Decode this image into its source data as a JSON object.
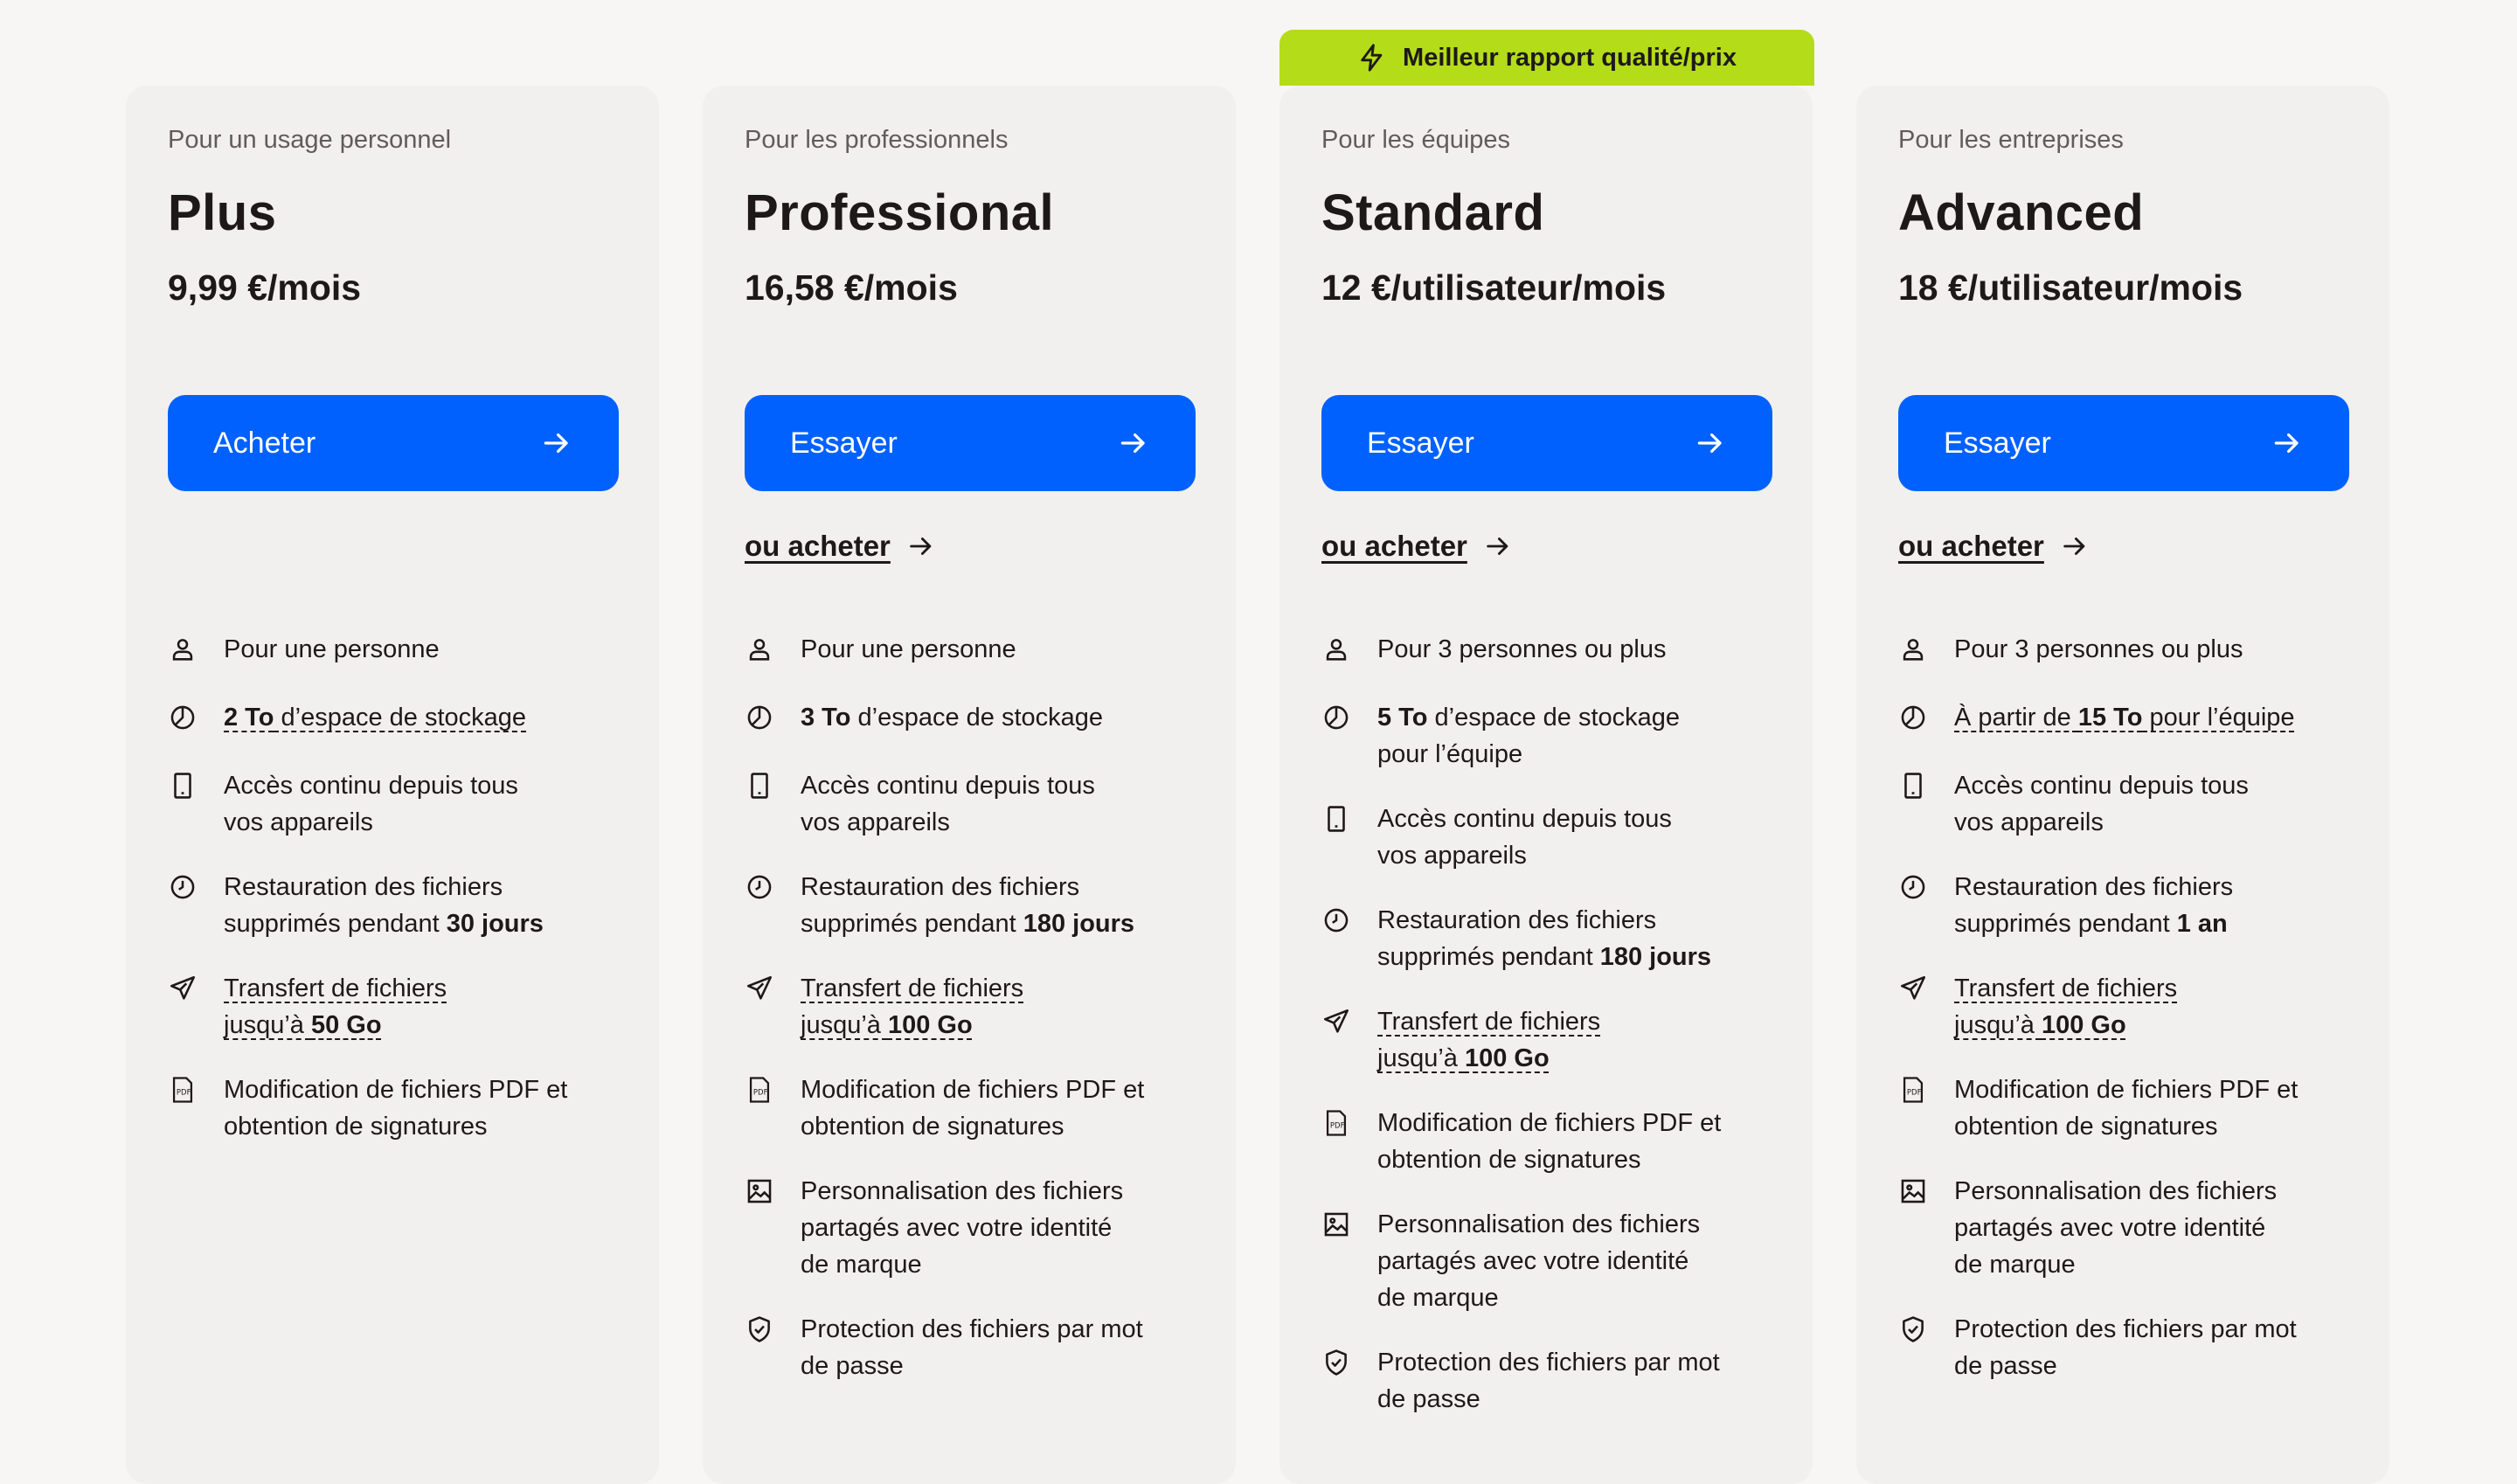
{
  "badge": {
    "icon": "lightning-icon",
    "label": "Meilleur rapport qualité/prix"
  },
  "plans": [
    {
      "audience": "Pour un usage personnel",
      "name": "Plus",
      "price": "9,99 €/mois",
      "cta_label": "Acheter",
      "features": {
        "people": "Pour une personne",
        "storage_value": "2 To",
        "storage_text": " d’espace de stockage",
        "access_line1": "Accès continu depuis tous",
        "access_line2": "vos appareils",
        "restore_line1": "Restauration des fichiers",
        "restore_prefix": "supprimés pendant ",
        "restore_value": "30 jours",
        "transfer_line1": "Transfert de fichiers",
        "transfer_prefix": "jusqu’à ",
        "transfer_value": "50 Go",
        "pdf_line1": "Modification de fichiers PDF et",
        "pdf_line2": "obtention de signatures"
      }
    },
    {
      "audience": "Pour les professionnels",
      "name": "Professional",
      "price": "16,58 €/mois",
      "cta_label": "Essayer",
      "buy_link": "ou acheter",
      "features": {
        "people": "Pour une personne",
        "storage_value": "3 To",
        "storage_text": " d’espace de stockage",
        "access_line1": "Accès continu depuis tous",
        "access_line2": "vos appareils",
        "restore_line1": "Restauration des fichiers",
        "restore_prefix": "supprimés pendant ",
        "restore_value": "180 jours",
        "transfer_line1": "Transfert de fichiers",
        "transfer_prefix": "jusqu’à ",
        "transfer_value": "100 Go",
        "pdf_line1": "Modification de fichiers PDF et",
        "pdf_line2": "obtention de signatures",
        "brand_line1": "Personnalisation des fichiers",
        "brand_line2": "partagés avec votre identité",
        "brand_line3": "de marque",
        "password_line1": "Protection des fichiers par mot",
        "password_line2": "de passe"
      }
    },
    {
      "audience": "Pour les équipes",
      "name": "Standard",
      "price": "12 €/utilisateur/mois",
      "cta_label": "Essayer",
      "buy_link": "ou acheter",
      "features": {
        "people": "Pour 3 personnes ou plus",
        "storage_value": "5 To",
        "storage_text": " d’espace de stockage",
        "storage_line2": "pour l’équipe",
        "access_line1": "Accès continu depuis tous",
        "access_line2": "vos appareils",
        "restore_line1": "Restauration des fichiers",
        "restore_prefix": "supprimés pendant ",
        "restore_value": "180 jours",
        "transfer_line1": "Transfert de fichiers",
        "transfer_prefix": "jusqu’à ",
        "transfer_value": "100 Go",
        "pdf_line1": "Modification de fichiers PDF et",
        "pdf_line2": "obtention de signatures",
        "brand_line1": "Personnalisation des fichiers",
        "brand_line2": "partagés avec votre identité",
        "brand_line3": "de marque",
        "password_line1": "Protection des fichiers par mot",
        "password_line2": "de passe"
      }
    },
    {
      "audience": "Pour les entreprises",
      "name": "Advanced",
      "price": "18 €/utilisateur/mois",
      "cta_label": "Essayer",
      "buy_link": "ou acheter",
      "features": {
        "people": "Pour 3 personnes ou plus",
        "storage_prefix": "À partir de ",
        "storage_value": "15 To",
        "storage_text": " pour l’équipe",
        "access_line1": "Accès continu depuis tous",
        "access_line2": "vos appareils",
        "restore_line1": "Restauration des fichiers",
        "restore_prefix": "supprimés pendant ",
        "restore_value": "1 an",
        "transfer_line1": "Transfert de fichiers",
        "transfer_prefix": "jusqu’à ",
        "transfer_value": "100 Go",
        "pdf_line1": "Modification de fichiers PDF et",
        "pdf_line2": "obtention de signatures",
        "brand_line1": "Personnalisation des fichiers",
        "brand_line2": "partagés avec votre identité",
        "brand_line3": "de marque",
        "password_line1": "Protection des fichiers par mot",
        "password_line2": "de passe"
      }
    }
  ],
  "colors": {
    "page_bg": "#f7f6f5",
    "card_bg": "#f2f0ee",
    "cta_blue": "#0061fe",
    "badge_green": "#b4dc19",
    "text": "#1e1919"
  }
}
